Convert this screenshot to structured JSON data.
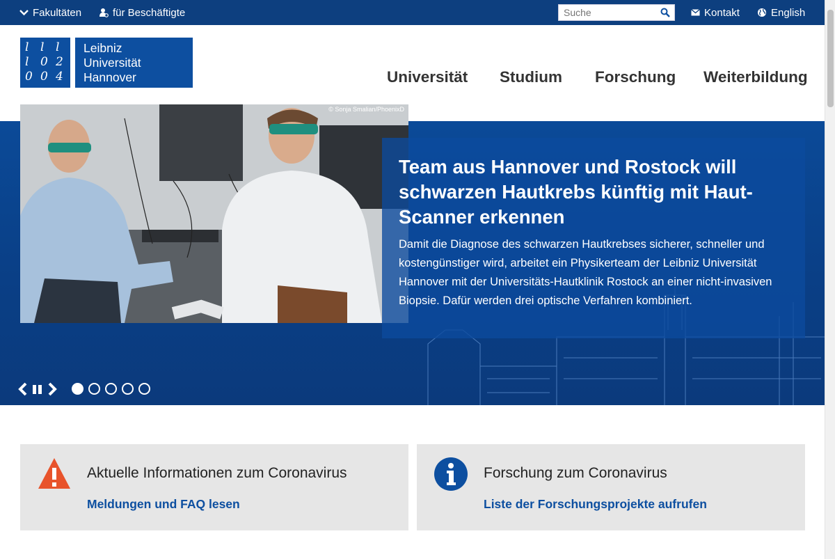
{
  "topbar": {
    "faculties": "Fakultäten",
    "employees": "für Beschäftigte",
    "search_placeholder": "Suche",
    "contact": "Kontakt",
    "language": "English"
  },
  "logo": {
    "line1": "Leibniz",
    "line2": "Universität",
    "line3": "Hannover",
    "mark": [
      "l",
      "l",
      "l",
      "0",
      "2",
      "l",
      "0",
      "0",
      "4"
    ]
  },
  "mainnav": [
    "Universität",
    "Studium",
    "Forschung",
    "Weiterbildung"
  ],
  "hero": {
    "photo_credit": "© Sonja Smalian/PhoenixD",
    "headline": "Team aus Hannover und Rostock will schwarzen Hautkrebs künftig mit Haut-Scanner erkennen",
    "body": "Damit die Diagnose des schwarzen Hautkrebses sicherer, schneller und kostengünstiger wird, arbeitet ein Physikerteam der Leibniz Universität Hannover mit der Universitäts-Hautklinik Rostock an einer nicht-invasiven Biopsie. Dafür werden drei optische Verfahren kombiniert.",
    "slides_total": 5,
    "slide_active": 1
  },
  "cards": [
    {
      "title": "Aktuelle Informationen zum Coronavirus",
      "link": "Meldungen und FAQ lesen",
      "icon": "warning-icon"
    },
    {
      "title": "Forschung zum Coronavirus",
      "link": "Liste der Forschungsprojekte aufrufen",
      "icon": "info-icon"
    }
  ],
  "colors": {
    "brand": "#0d4fa0",
    "topbar": "#0d3f7f",
    "warning": "#e8532b",
    "card_bg": "#e6e6e6"
  }
}
